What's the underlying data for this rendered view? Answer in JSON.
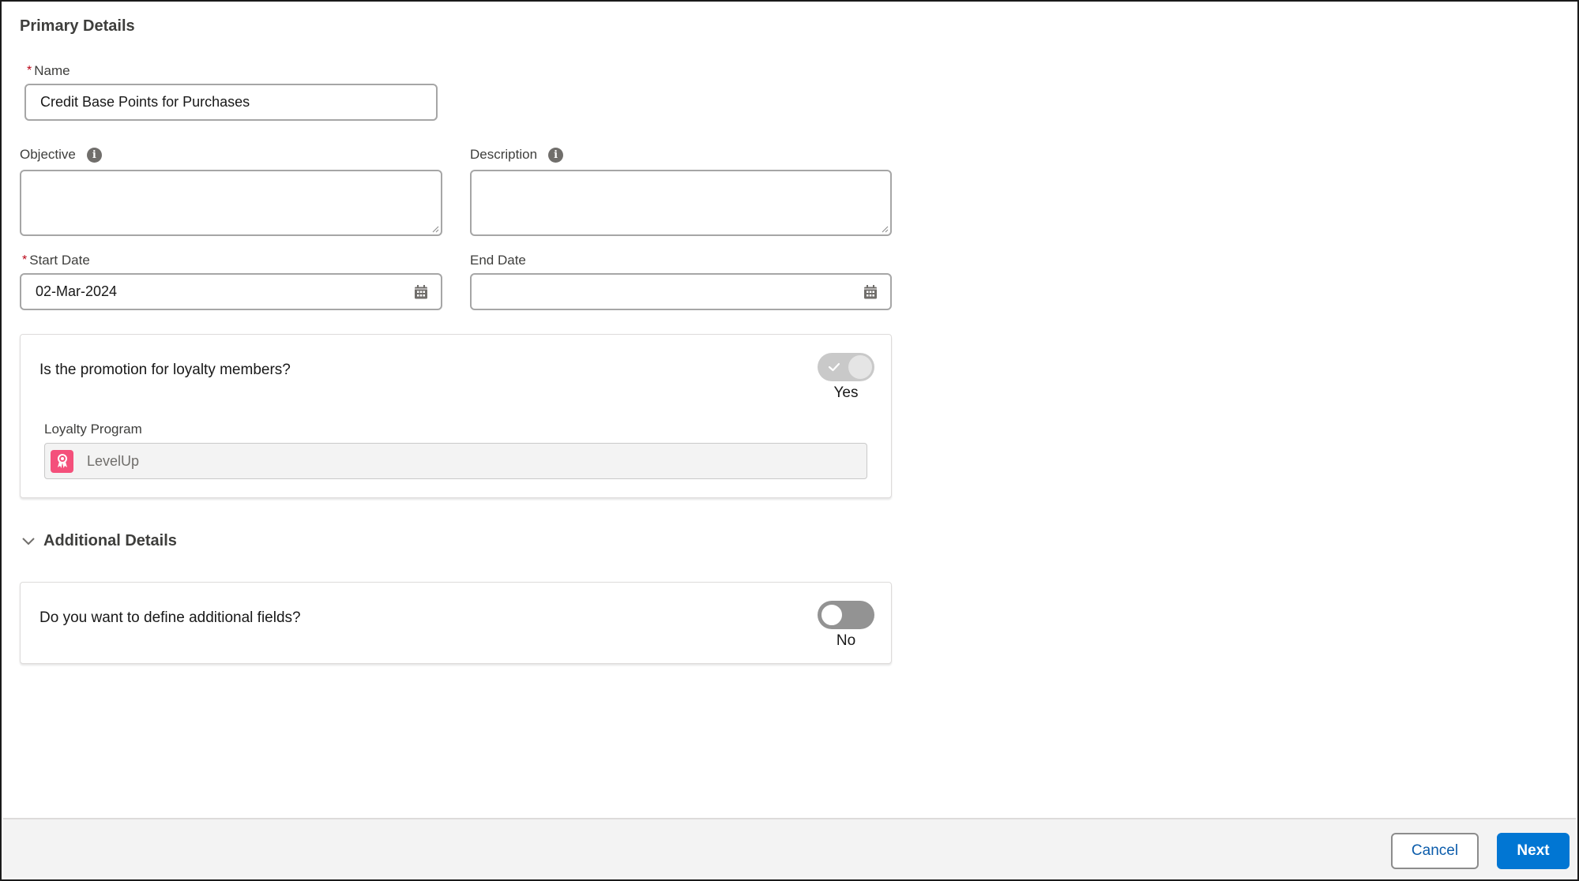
{
  "primary_details": {
    "title": "Primary Details",
    "name": {
      "label": "Name",
      "required_marker": "*",
      "value": "Credit Base Points for Purchases"
    },
    "objective": {
      "label": "Objective",
      "value": "",
      "info_icon": "info-icon"
    },
    "description": {
      "label": "Description",
      "value": "",
      "info_icon": "info-icon"
    },
    "start_date": {
      "label": "Start Date",
      "required_marker": "*",
      "value": "02-Mar-2024",
      "icon": "calendar-icon"
    },
    "end_date": {
      "label": "End Date",
      "value": "",
      "icon": "calendar-icon"
    },
    "loyalty_card": {
      "question": "Is the promotion for loyalty members?",
      "toggle_checked": true,
      "toggle_disabled": true,
      "toggle_label": "Yes",
      "loyalty_program": {
        "label": "Loyalty Program",
        "value": "LevelUp",
        "icon": "loyalty-program-icon",
        "icon_color": "#f4507b"
      }
    }
  },
  "additional_details": {
    "title": "Additional Details",
    "expanded": true,
    "card": {
      "question": "Do you want to define additional fields?",
      "toggle_checked": false,
      "toggle_label": "No"
    }
  },
  "footer": {
    "cancel_label": "Cancel",
    "next_label": "Next"
  },
  "colors": {
    "brand": "#0176d3",
    "required": "#ba0517",
    "footer_bg": "#f3f3f3"
  }
}
